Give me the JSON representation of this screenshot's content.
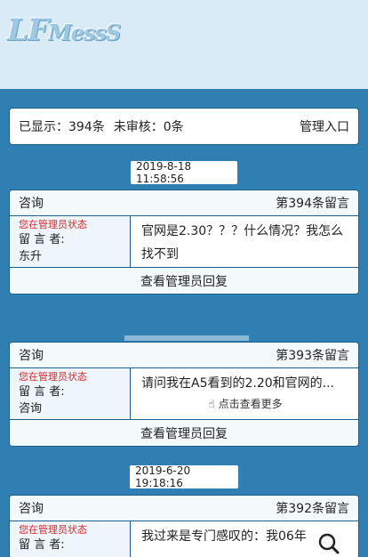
{
  "logo": {
    "text_big": "LF",
    "text_small": "MessS"
  },
  "stats": {
    "shown_label": "已显示：",
    "shown_value": "394条",
    "pending_label": "未审核：",
    "pending_value": "0条",
    "admin_link": "管理入口"
  },
  "messages": [
    {
      "date": "2019-8-18 11:58:56",
      "category": "咨询",
      "number": "第394条留言",
      "admin_status": "您在管理员状态",
      "author_label": "留 言 者:",
      "author": "东升",
      "content": "官网是2.30？？？什么情况？我怎么找不到",
      "reply_button": "查看管理员回复"
    },
    {
      "date": "",
      "category": "咨询",
      "number": "第393条留言",
      "admin_status": "您在管理员状态",
      "author_label": "留 言 者:",
      "author": "咨询",
      "content": "请问我在A5看到的2.20和官网的...",
      "more_label": "点击查看更多",
      "reply_button": "查看管理员回复"
    },
    {
      "date": "2019-6-20 19:18:16",
      "category": "咨询",
      "number": "第392条留言",
      "admin_status": "您在管理员状态",
      "author_label": "留 言 者:",
      "author": "",
      "content": "我过来是专门感叹的：我06年"
    }
  ],
  "colors": {
    "page_bg": "#2f7fb2",
    "header_bg": "#d8ebf7",
    "admin_red": "#d42a2a"
  },
  "icons": {
    "more": "hand-pointer-icon",
    "zoom": "search-icon"
  }
}
